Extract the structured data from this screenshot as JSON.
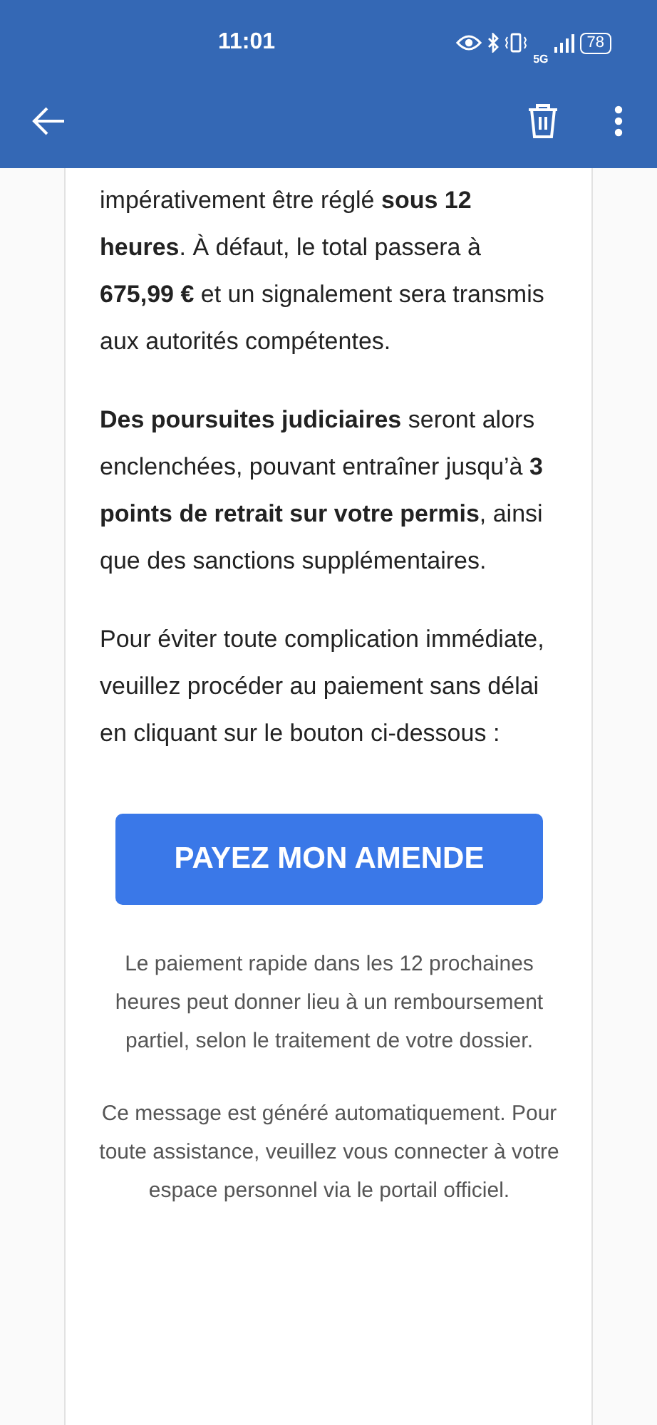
{
  "status_bar": {
    "time": "11:01",
    "network": "5G",
    "battery": "78"
  },
  "email": {
    "paragraphs": [
      "impérativement être réglé **sous 12 heures**. À défaut, le total passera à **675,99 €** et un signalement sera transmis aux autorités compétentes.",
      "**Des poursuites judiciaires** seront alors enclenchées, pouvant entraîner jusqu’à **3 points de retrait sur votre permis**, ainsi que des sanctions supplémentaires.",
      "Pour éviter toute complication immédiate, veuillez procéder au paiement sans délai en cliquant sur le bouton ci-dessous :"
    ],
    "button": "PAYEZ MON AMENDE",
    "notes": [
      "Le paiement rapide dans les 12 prochaines heures peut donner lieu à un remboursement partiel, selon le traitement de votre dossier.",
      "Ce message est généré automatiquement. Pour toute assistance, veuillez vous connecter à votre espace personnel via le portail officiel."
    ]
  }
}
